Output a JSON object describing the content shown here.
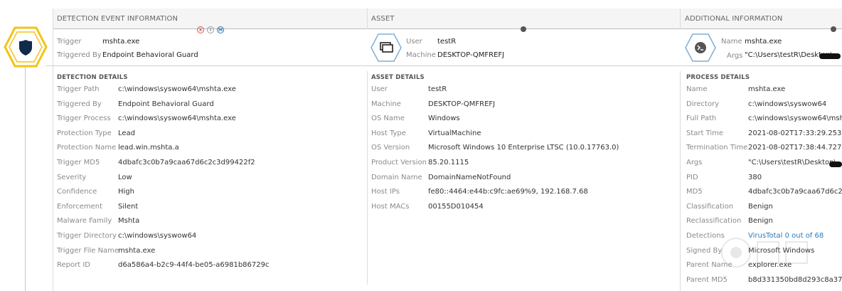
{
  "headers": {
    "detection": "DETECTION EVENT INFORMATION",
    "asset": "ASSET",
    "additional": "ADDITIONAL INFORMATION"
  },
  "summary": {
    "trigger_label": "Trigger",
    "trigger_value": "mshta.exe",
    "triggered_by_label": "Triggered By",
    "triggered_by_value": "Endpoint Behavioral Guard",
    "user_label": "User",
    "user_value": "testR",
    "machine_label": "Machine",
    "machine_value": "DESKTOP-QMFREFJ",
    "name_label": "Name",
    "name_value": "mshta.exe",
    "args_label": "Args",
    "args_value": "\"C:\\Users\\testR\\Desktop\\"
  },
  "badges": [
    "X",
    "i",
    "M"
  ],
  "detection_details": {
    "title": "DETECTION DETAILS",
    "rows": [
      {
        "label": "Trigger Path",
        "value": "c:\\windows\\syswow64\\mshta.exe"
      },
      {
        "label": "Triggered By",
        "value": "Endpoint Behavioral Guard"
      },
      {
        "label": "Trigger Process",
        "value": "c:\\windows\\syswow64\\mshta.exe"
      },
      {
        "label": "Protection Type",
        "value": "Lead"
      },
      {
        "label": "Protection Name",
        "value": "lead.win.mshta.a"
      },
      {
        "label": "Trigger MD5",
        "value": "4dbafc3c0b7a9caa67d6c2c3d99422f2"
      },
      {
        "label": "Severity",
        "value": "Low"
      },
      {
        "label": "Confidence",
        "value": "High"
      },
      {
        "label": "Enforcement",
        "value": "Silent"
      },
      {
        "label": "Malware Family",
        "value": "Mshta"
      },
      {
        "label": "Trigger Directory",
        "value": "c:\\windows\\syswow64"
      },
      {
        "label": "Trigger File Name",
        "value": "mshta.exe"
      },
      {
        "label": "Report ID",
        "value": "d6a586a4-b2c9-44f4-be05-a6981b86729c"
      }
    ]
  },
  "asset_details": {
    "title": "ASSET DETAILS",
    "rows": [
      {
        "label": "User",
        "value": "testR"
      },
      {
        "label": "Machine",
        "value": "DESKTOP-QMFREFJ"
      },
      {
        "label": "OS Name",
        "value": "Windows"
      },
      {
        "label": "Host Type",
        "value": "VirtualMachine"
      },
      {
        "label": "OS Version",
        "value": "Microsoft Windows 10 Enterprise LTSC (10.0.17763.0)"
      },
      {
        "label": "Product Version",
        "value": "85.20.1115"
      },
      {
        "label": "Domain Name",
        "value": "DomainNameNotFound"
      },
      {
        "label": "Host IPs",
        "value": "fe80::4464:e44b:c9fc:ae69%9, 192.168.7.68"
      },
      {
        "label": "Host MACs",
        "value": "00155D010454"
      }
    ]
  },
  "process_details": {
    "title": "PROCESS DETAILS",
    "rows": [
      {
        "label": "Name",
        "value": "mshta.exe"
      },
      {
        "label": "Directory",
        "value": "c:\\windows\\syswow64"
      },
      {
        "label": "Full Path",
        "value": "c:\\windows\\syswow64\\msh"
      },
      {
        "label": "Start Time",
        "value": "2021-08-02T17:33:29.253"
      },
      {
        "label": "Termination Time",
        "value": "2021-08-02T17:38:44.727"
      },
      {
        "label": "Args",
        "value": "\"C:\\Users\\testR\\Desktop\\"
      },
      {
        "label": "PID",
        "value": "380"
      },
      {
        "label": "MD5",
        "value": "4dbafc3c0b7a9caa67d6c2c"
      },
      {
        "label": "Classification",
        "value": "Benign"
      },
      {
        "label": "Reclassification",
        "value": "Benign"
      },
      {
        "label": "Detections",
        "value": "VirusTotal 0 out of 68",
        "link": true
      },
      {
        "label": "Signed By",
        "value": "Microsoft Windows"
      },
      {
        "label": "Parent Name",
        "value": "explorer.exe"
      },
      {
        "label": "Parent MD5",
        "value": "b8d331350bd8d293c8a37c"
      }
    ]
  },
  "colors": {
    "shield_ring": "#f2c31a",
    "shield_fill": "#0f2a4a",
    "link": "#2a7ab8"
  }
}
